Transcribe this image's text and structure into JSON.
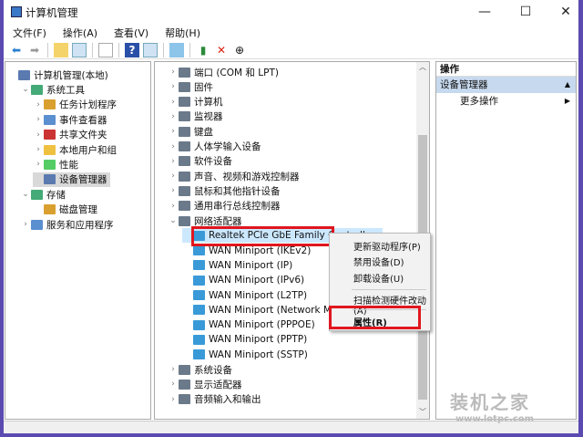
{
  "window": {
    "title": "计算机管理",
    "min": "—",
    "max": "☐",
    "close": "✕"
  },
  "menu": [
    "文件(F)",
    "操作(A)",
    "查看(V)",
    "帮助(H)"
  ],
  "toolbar": [
    "back",
    "forward",
    "up",
    "show-hide-tree",
    "properties",
    "help",
    "show-action-pane",
    "connect",
    "enable-device",
    "uninstall",
    "update-driver"
  ],
  "left_tree": [
    {
      "label": "计算机管理(本地)",
      "level": 0,
      "arrow": ""
    },
    {
      "label": "系统工具",
      "level": 1,
      "arrow": "⌄"
    },
    {
      "label": "任务计划程序",
      "level": 2,
      "arrow": "›"
    },
    {
      "label": "事件查看器",
      "level": 2,
      "arrow": "›"
    },
    {
      "label": "共享文件夹",
      "level": 2,
      "arrow": "›"
    },
    {
      "label": "本地用户和组",
      "level": 2,
      "arrow": "›"
    },
    {
      "label": "性能",
      "level": 2,
      "arrow": "›"
    },
    {
      "label": "设备管理器",
      "level": 2,
      "arrow": "",
      "selected": true
    },
    {
      "label": "存储",
      "level": 1,
      "arrow": "⌄"
    },
    {
      "label": "磁盘管理",
      "level": 2,
      "arrow": ""
    },
    {
      "label": "服务和应用程序",
      "level": 1,
      "arrow": "›"
    }
  ],
  "device_tree": [
    {
      "label": "端口 (COM 和 LPT)",
      "arrow": "›",
      "level": 0
    },
    {
      "label": "固件",
      "arrow": "›",
      "level": 0
    },
    {
      "label": "计算机",
      "arrow": "›",
      "level": 0
    },
    {
      "label": "监视器",
      "arrow": "›",
      "level": 0
    },
    {
      "label": "键盘",
      "arrow": "›",
      "level": 0
    },
    {
      "label": "人体学输入设备",
      "arrow": "›",
      "level": 0
    },
    {
      "label": "软件设备",
      "arrow": "›",
      "level": 0
    },
    {
      "label": "声音、视频和游戏控制器",
      "arrow": "›",
      "level": 0
    },
    {
      "label": "鼠标和其他指针设备",
      "arrow": "›",
      "level": 0
    },
    {
      "label": "通用串行总线控制器",
      "arrow": "›",
      "level": 0
    },
    {
      "label": "网络适配器",
      "arrow": "⌄",
      "level": 0
    },
    {
      "label": "Realtek PCIe GbE Family Controller",
      "arrow": "",
      "level": 1,
      "selected": true
    },
    {
      "label": "WAN Miniport (IKEv2)",
      "arrow": "",
      "level": 1
    },
    {
      "label": "WAN Miniport (IP)",
      "arrow": "",
      "level": 1
    },
    {
      "label": "WAN Miniport (IPv6)",
      "arrow": "",
      "level": 1
    },
    {
      "label": "WAN Miniport (L2TP)",
      "arrow": "",
      "level": 1
    },
    {
      "label": "WAN Miniport (Network Monitor)",
      "arrow": "",
      "level": 1
    },
    {
      "label": "WAN Miniport (PPPOE)",
      "arrow": "",
      "level": 1
    },
    {
      "label": "WAN Miniport (PPTP)",
      "arrow": "",
      "level": 1
    },
    {
      "label": "WAN Miniport (SSTP)",
      "arrow": "",
      "level": 1
    },
    {
      "label": "系统设备",
      "arrow": "›",
      "level": 0
    },
    {
      "label": "显示适配器",
      "arrow": "›",
      "level": 0
    },
    {
      "label": "音频输入和输出",
      "arrow": "›",
      "level": 0
    }
  ],
  "actions": {
    "header": "操作",
    "section": "设备管理器",
    "more": "更多操作"
  },
  "context_menu": [
    "更新驱动程序(P)",
    "禁用设备(D)",
    "卸载设备(U)",
    "扫描检测硬件改动(A)",
    "属性(R)"
  ],
  "watermark": {
    "name": "装机之家",
    "url": "www.lotpc.com"
  },
  "colors": {
    "highlight": "#e0161e",
    "selection": "#cce8ff",
    "action_header": "#c7d9ee"
  }
}
